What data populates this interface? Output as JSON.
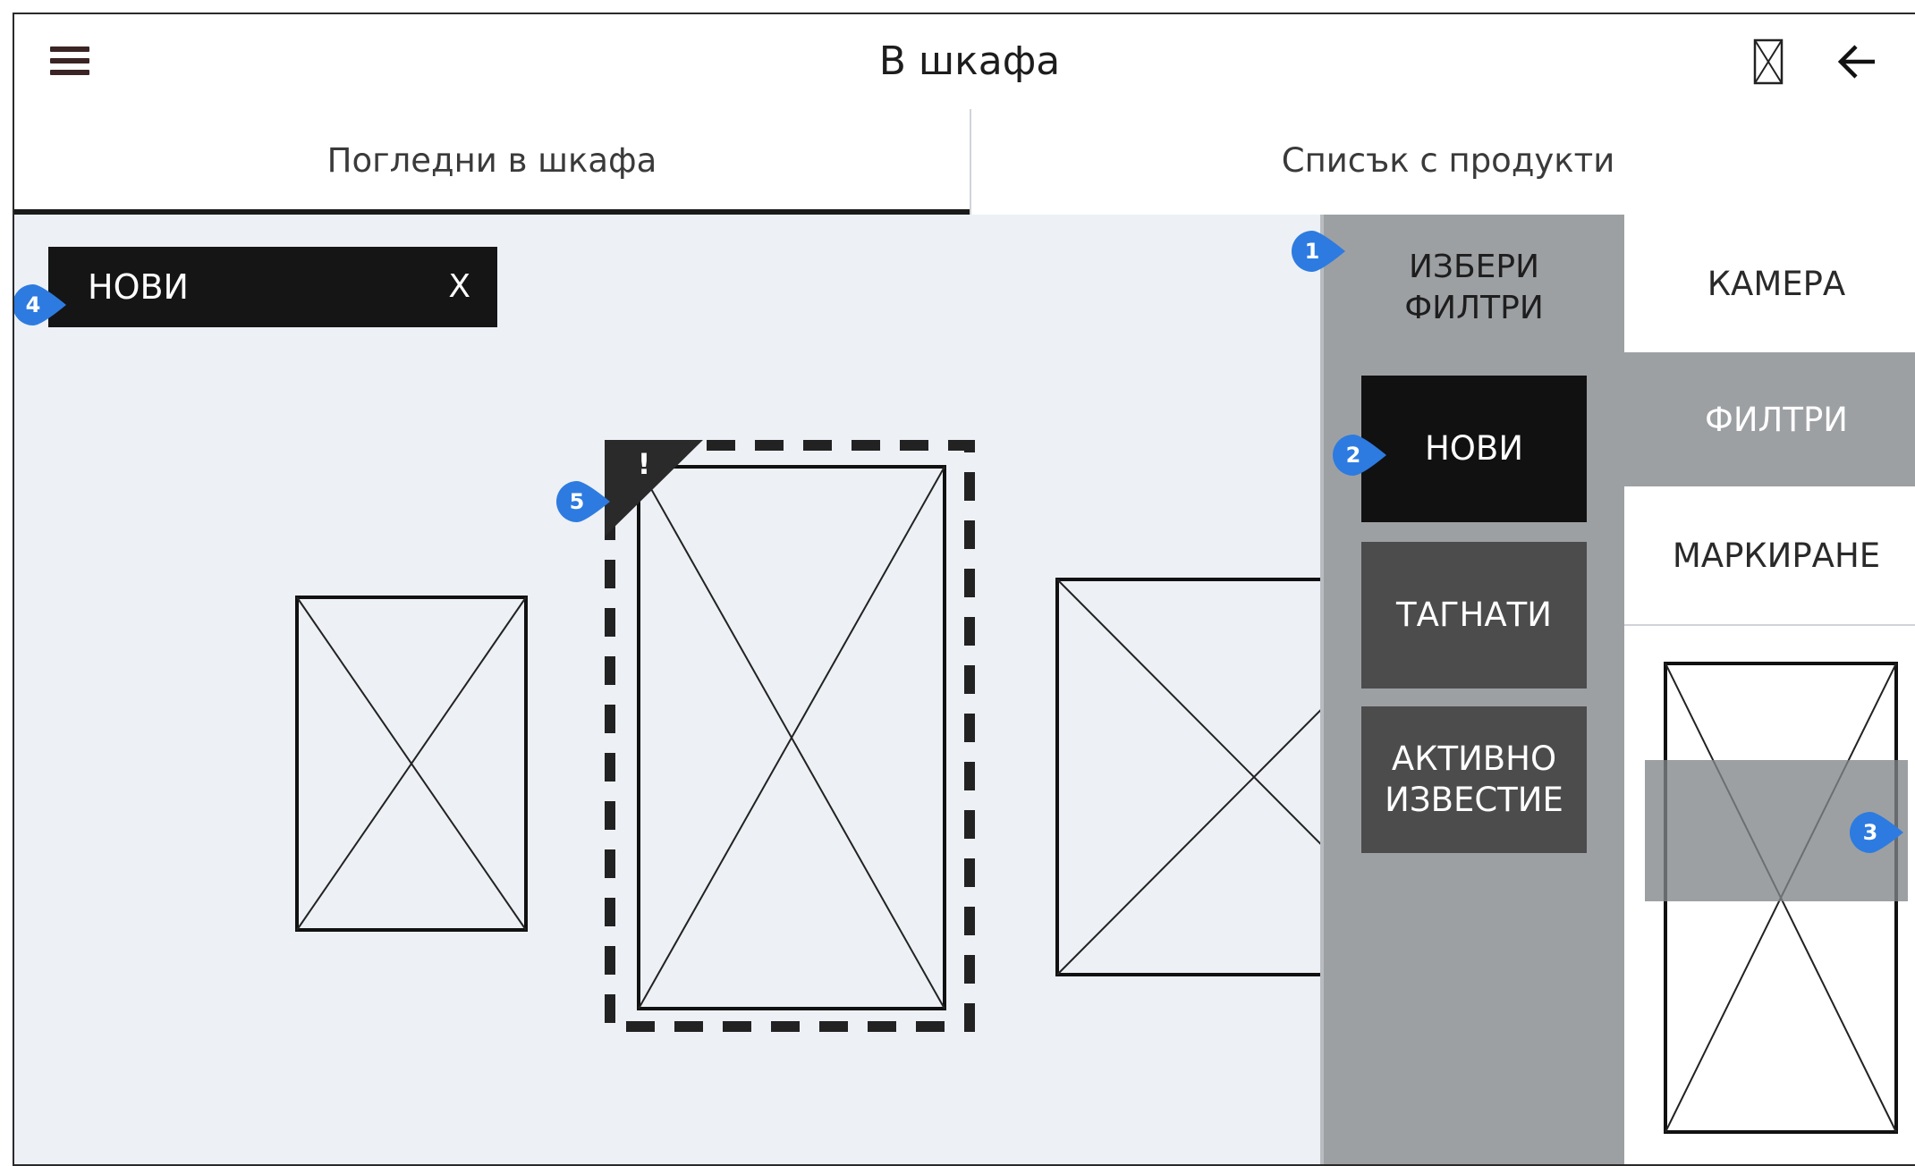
{
  "header": {
    "title": "В шкафа",
    "menu_icon": "hamburger-menu-icon",
    "placeholder_icon": "image-placeholder-icon",
    "back_icon": "arrow-left-icon"
  },
  "tabs": [
    {
      "label": "Погледни в шкафа",
      "active": true
    },
    {
      "label": "Списък с продукти",
      "active": false
    }
  ],
  "active_filter_chip": {
    "label": "НОВИ",
    "close_label": "X"
  },
  "alert_badge": "!",
  "filter_panel": {
    "title": "ИЗБЕРИ\nФИЛТРИ",
    "options": [
      {
        "label": "НОВИ",
        "selected": true
      },
      {
        "label": "ТАГНАТИ",
        "selected": false
      },
      {
        "label": "АКТИВНО\nИЗВЕСТИЕ",
        "selected": false
      }
    ]
  },
  "side_actions": [
    {
      "label": "КАМЕРА",
      "active": false
    },
    {
      "label": "ФИЛТРИ",
      "active": true
    },
    {
      "label": "МАРКИРАНЕ",
      "active": false
    }
  ],
  "annotations": [
    "1",
    "2",
    "3",
    "4",
    "5"
  ],
  "colors": {
    "marker": "#2d7be0",
    "canvas_bg": "#edf0f4",
    "panel_grey": "#9da0a3",
    "selected": "#111111",
    "button_dark": "#4c4c4c"
  }
}
